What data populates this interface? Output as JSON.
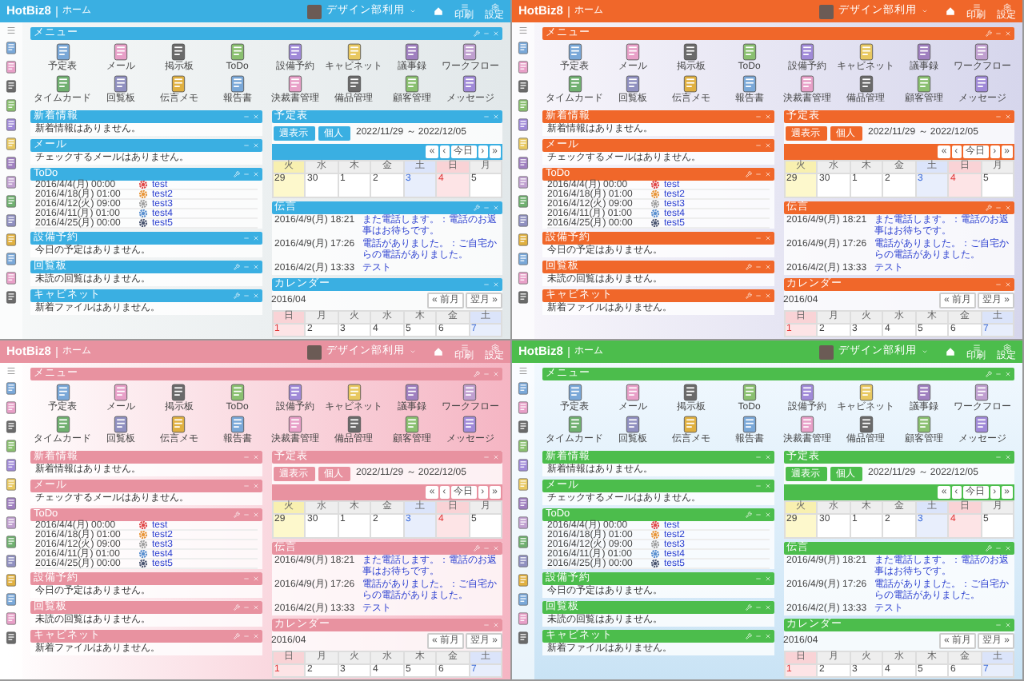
{
  "screens": [
    {
      "kind": "waves",
      "color": "#3aafe2",
      "logo": "HotBiz8",
      "page": "ホーム",
      "user": "デザイン部利用",
      "header_labels": [
        "印刷",
        "設定"
      ],
      "menu": {
        "title": "メニュー",
        "items": [
          "予定表",
          "メール",
          "掲示板",
          "ToDo",
          "設備予約",
          "キャビネット",
          "議事録",
          "ワークフロー",
          "タイムカード",
          "回覧板",
          "伝言メモ",
          "報告書",
          "決裁書管理",
          "備品管理",
          "顧客管理",
          "メッセージ"
        ]
      },
      "left_panels": [
        {
          "kind": "message",
          "title": "新着情報",
          "settings": false,
          "text": "新着情報はありません。"
        },
        {
          "kind": "message",
          "title": "メール",
          "settings": false,
          "text": "チェックするメールはありません。"
        },
        {
          "kind": "todo",
          "title": "ToDo",
          "settings": true,
          "rows": [
            {
              "date": "2016/4/4(月) 00:00",
              "name": "test",
              "color": "#e04848"
            },
            {
              "date": "2016/4/18(月) 01:00",
              "name": "test2",
              "color": "#e8963a"
            },
            {
              "date": "2016/4/12(火) 09:00",
              "name": "test3",
              "color": "#a0a0a0"
            },
            {
              "date": "2016/4/11(月) 01:00",
              "name": "test4",
              "color": "#5a90d0"
            },
            {
              "date": "2016/4/25(月) 00:00",
              "name": "test5",
              "color": "#4a5570"
            }
          ]
        },
        {
          "kind": "message",
          "title": "設備予約",
          "settings": false,
          "text": "今日の予定はありません。"
        },
        {
          "kind": "message",
          "title": "回覧板",
          "settings": true,
          "text": "未読の回覧はありません。"
        },
        {
          "kind": "message",
          "title": "キャビネット",
          "settings": true,
          "text": "新着ファイルはありません。"
        }
      ],
      "schedule": {
        "title": "予定表",
        "buttons": [
          "週表示",
          "個人"
        ],
        "range": "2022/11/29 ～ 2022/12/05",
        "nav": [
          "«",
          "‹",
          "今日",
          "›",
          "»"
        ],
        "columns": [
          {
            "head": "火",
            "day": "29",
            "kind": "today"
          },
          {
            "head": "水",
            "day": "30",
            "kind": "day"
          },
          {
            "head": "木",
            "day": "1",
            "kind": "day"
          },
          {
            "head": "金",
            "day": "2",
            "kind": "day"
          },
          {
            "head": "土",
            "day": "3",
            "kind": "sat"
          },
          {
            "head": "日",
            "day": "4",
            "kind": "sun"
          },
          {
            "head": "月",
            "day": "5",
            "kind": "day"
          }
        ]
      },
      "memo": {
        "title": "伝言",
        "rows": [
          {
            "time": "2016/4/9(月) 18:21",
            "text": "また電話します。：電話のお返事はお待ちです。"
          },
          {
            "time": "2016/4/9(月) 17:26",
            "text": "電話がありました。：ご自宅からの電話がありました。"
          },
          {
            "time": "2016/4/2(月) 13:33",
            "text": "テスト"
          }
        ]
      },
      "calendar": {
        "title": "カレンダー",
        "month": "2016/04",
        "nav": [
          "« 前月",
          "翌月 »"
        ],
        "columns": [
          {
            "head": "日",
            "day": "1",
            "kind": "sun"
          },
          {
            "head": "月",
            "day": "2",
            "kind": "day"
          },
          {
            "head": "火",
            "day": "3",
            "kind": "day"
          },
          {
            "head": "水",
            "day": "4",
            "kind": "day"
          },
          {
            "head": "木",
            "day": "5",
            "kind": "day"
          },
          {
            "head": "金",
            "day": "6",
            "kind": "day"
          },
          {
            "head": "土",
            "day": "7",
            "kind": "sat"
          }
        ]
      }
    },
    {
      "kind": "bubbles",
      "color": "#f0672a",
      "logo": "HotBiz8",
      "page": "ホーム",
      "user": "デザイン部利用",
      "header_labels": [
        "印刷",
        "設定"
      ],
      "menu": {
        "title": "メニュー",
        "items": [
          "予定表",
          "メール",
          "掲示板",
          "ToDo",
          "設備予約",
          "キャビネット",
          "議事録",
          "ワークフロー",
          "タイムカード",
          "回覧板",
          "伝言メモ",
          "報告書",
          "決裁書管理",
          "備品管理",
          "顧客管理",
          "メッセージ"
        ]
      },
      "left_panels": [
        {
          "kind": "message",
          "title": "新着情報",
          "settings": false,
          "text": "新着情報はありません。"
        },
        {
          "kind": "message",
          "title": "メール",
          "settings": false,
          "text": "チェックするメールはありません。"
        },
        {
          "kind": "todo",
          "title": "ToDo",
          "settings": true,
          "rows": [
            {
              "date": "2016/4/4(月) 00:00",
              "name": "test",
              "color": "#e04848"
            },
            {
              "date": "2016/4/18(月) 01:00",
              "name": "test2",
              "color": "#e8963a"
            },
            {
              "date": "2016/4/12(火) 09:00",
              "name": "test3",
              "color": "#a0a0a0"
            },
            {
              "date": "2016/4/11(月) 01:00",
              "name": "test4",
              "color": "#5a90d0"
            },
            {
              "date": "2016/4/25(月) 00:00",
              "name": "test5",
              "color": "#4a5570"
            }
          ]
        },
        {
          "kind": "message",
          "title": "設備予約",
          "settings": false,
          "text": "今日の予定はありません。"
        },
        {
          "kind": "message",
          "title": "回覧板",
          "settings": true,
          "text": "未読の回覧はありません。"
        },
        {
          "kind": "message",
          "title": "キャビネット",
          "settings": true,
          "text": "新着ファイルはありません。"
        }
      ],
      "schedule": {
        "title": "予定表",
        "buttons": [
          "週表示",
          "個人"
        ],
        "range": "2022/11/29 ～ 2022/12/05",
        "nav": [
          "«",
          "‹",
          "今日",
          "›",
          "»"
        ],
        "columns": [
          {
            "head": "火",
            "day": "29",
            "kind": "today"
          },
          {
            "head": "水",
            "day": "30",
            "kind": "day"
          },
          {
            "head": "木",
            "day": "1",
            "kind": "day"
          },
          {
            "head": "金",
            "day": "2",
            "kind": "day"
          },
          {
            "head": "土",
            "day": "3",
            "kind": "sat"
          },
          {
            "head": "日",
            "day": "4",
            "kind": "sun"
          },
          {
            "head": "月",
            "day": "5",
            "kind": "day"
          }
        ]
      },
      "memo": {
        "title": "伝言",
        "rows": [
          {
            "time": "2016/4/9(月) 18:21",
            "text": "また電話します。：電話のお返事はお待ちです。"
          },
          {
            "time": "2016/4/9(月) 17:26",
            "text": "電話がありました。：ご自宅からの電話がありました。"
          },
          {
            "time": "2016/4/2(月) 13:33",
            "text": "テスト"
          }
        ]
      },
      "calendar": {
        "title": "カレンダー",
        "month": "2016/04",
        "nav": [
          "« 前月",
          "翌月 »"
        ],
        "columns": [
          {
            "head": "日",
            "day": "1",
            "kind": "sun"
          },
          {
            "head": "月",
            "day": "2",
            "kind": "day"
          },
          {
            "head": "火",
            "day": "3",
            "kind": "day"
          },
          {
            "head": "水",
            "day": "4",
            "kind": "day"
          },
          {
            "head": "木",
            "day": "5",
            "kind": "day"
          },
          {
            "head": "金",
            "day": "6",
            "kind": "day"
          },
          {
            "head": "土",
            "day": "7",
            "kind": "sat"
          }
        ]
      }
    },
    {
      "kind": "sakura",
      "color": "#e892a0",
      "logo": "HotBiz8",
      "page": "ホーム",
      "user": "デザイン部利用",
      "header_labels": [
        "印刷",
        "設定"
      ],
      "menu": {
        "title": "メニュー",
        "items": [
          "予定表",
          "メール",
          "掲示板",
          "ToDo",
          "設備予約",
          "キャビネット",
          "議事録",
          "ワークフロー",
          "タイムカード",
          "回覧板",
          "伝言メモ",
          "報告書",
          "決裁書管理",
          "備品管理",
          "顧客管理",
          "メッセージ"
        ]
      },
      "left_panels": [
        {
          "kind": "message",
          "title": "新着情報",
          "settings": false,
          "text": "新着情報はありません。"
        },
        {
          "kind": "message",
          "title": "メール",
          "settings": false,
          "text": "チェックするメールはありません。"
        },
        {
          "kind": "todo",
          "title": "ToDo",
          "settings": true,
          "rows": [
            {
              "date": "2016/4/4(月) 00:00",
              "name": "test",
              "color": "#e04848"
            },
            {
              "date": "2016/4/18(月) 01:00",
              "name": "test2",
              "color": "#e8963a"
            },
            {
              "date": "2016/4/12(火) 09:00",
              "name": "test3",
              "color": "#a0a0a0"
            },
            {
              "date": "2016/4/11(月) 01:00",
              "name": "test4",
              "color": "#5a90d0"
            },
            {
              "date": "2016/4/25(月) 00:00",
              "name": "test5",
              "color": "#4a5570"
            }
          ]
        },
        {
          "kind": "message",
          "title": "設備予約",
          "settings": false,
          "text": "今日の予定はありません。"
        },
        {
          "kind": "message",
          "title": "回覧板",
          "settings": true,
          "text": "未読の回覧はありません。"
        },
        {
          "kind": "message",
          "title": "キャビネット",
          "settings": true,
          "text": "新着ファイルはありません。"
        }
      ],
      "schedule": {
        "title": "予定表",
        "buttons": [
          "週表示",
          "個人"
        ],
        "range": "2022/11/29 ～ 2022/12/05",
        "nav": [
          "«",
          "‹",
          "今日",
          "›",
          "»"
        ],
        "columns": [
          {
            "head": "火",
            "day": "29",
            "kind": "today"
          },
          {
            "head": "水",
            "day": "30",
            "kind": "day"
          },
          {
            "head": "木",
            "day": "1",
            "kind": "day"
          },
          {
            "head": "金",
            "day": "2",
            "kind": "day"
          },
          {
            "head": "土",
            "day": "3",
            "kind": "sat"
          },
          {
            "head": "日",
            "day": "4",
            "kind": "sun"
          },
          {
            "head": "月",
            "day": "5",
            "kind": "day"
          }
        ]
      },
      "memo": {
        "title": "伝言",
        "rows": [
          {
            "time": "2016/4/9(月) 18:21",
            "text": "また電話します。：電話のお返事はお待ちです。"
          },
          {
            "time": "2016/4/9(月) 17:26",
            "text": "電話がありました。：ご自宅からの電話がありました。"
          },
          {
            "time": "2016/4/2(月) 13:33",
            "text": "テスト"
          }
        ]
      },
      "calendar": {
        "title": "カレンダー",
        "month": "2016/04",
        "nav": [
          "« 前月",
          "翌月 »"
        ],
        "columns": [
          {
            "head": "日",
            "day": "1",
            "kind": "sun"
          },
          {
            "head": "月",
            "day": "2",
            "kind": "day"
          },
          {
            "head": "火",
            "day": "3",
            "kind": "day"
          },
          {
            "head": "水",
            "day": "4",
            "kind": "day"
          },
          {
            "head": "木",
            "day": "5",
            "kind": "day"
          },
          {
            "head": "金",
            "day": "6",
            "kind": "day"
          },
          {
            "head": "土",
            "day": "7",
            "kind": "sat"
          }
        ]
      }
    },
    {
      "kind": "sky",
      "color": "#4cbd4c",
      "logo": "HotBiz8",
      "page": "ホーム",
      "user": "デザイン部利用",
      "header_labels": [
        "印刷",
        "設定"
      ],
      "menu": {
        "title": "メニュー",
        "items": [
          "予定表",
          "メール",
          "掲示板",
          "ToDo",
          "設備予約",
          "キャビネット",
          "議事録",
          "ワークフロー",
          "タイムカード",
          "回覧板",
          "伝言メモ",
          "報告書",
          "決裁書管理",
          "備品管理",
          "顧客管理",
          "メッセージ"
        ]
      },
      "left_panels": [
        {
          "kind": "message",
          "title": "新着情報",
          "settings": false,
          "text": "新着情報はありません。"
        },
        {
          "kind": "message",
          "title": "メール",
          "settings": false,
          "text": "チェックするメールはありません。"
        },
        {
          "kind": "todo",
          "title": "ToDo",
          "settings": true,
          "rows": [
            {
              "date": "2016/4/4(月) 00:00",
              "name": "test",
              "color": "#e04848"
            },
            {
              "date": "2016/4/18(月) 01:00",
              "name": "test2",
              "color": "#e8963a"
            },
            {
              "date": "2016/4/12(火) 09:00",
              "name": "test3",
              "color": "#a0a0a0"
            },
            {
              "date": "2016/4/11(月) 01:00",
              "name": "test4",
              "color": "#5a90d0"
            },
            {
              "date": "2016/4/25(月) 00:00",
              "name": "test5",
              "color": "#4a5570"
            }
          ]
        },
        {
          "kind": "message",
          "title": "設備予約",
          "settings": false,
          "text": "今日の予定はありません。"
        },
        {
          "kind": "message",
          "title": "回覧板",
          "settings": true,
          "text": "未読の回覧はありません。"
        },
        {
          "kind": "message",
          "title": "キャビネット",
          "settings": true,
          "text": "新着ファイルはありません。"
        }
      ],
      "schedule": {
        "title": "予定表",
        "buttons": [
          "週表示",
          "個人"
        ],
        "range": "2022/11/29 ～ 2022/12/05",
        "nav": [
          "«",
          "‹",
          "今日",
          "›",
          "»"
        ],
        "columns": [
          {
            "head": "火",
            "day": "29",
            "kind": "today"
          },
          {
            "head": "水",
            "day": "30",
            "kind": "day"
          },
          {
            "head": "木",
            "day": "1",
            "kind": "day"
          },
          {
            "head": "金",
            "day": "2",
            "kind": "day"
          },
          {
            "head": "土",
            "day": "3",
            "kind": "sat"
          },
          {
            "head": "日",
            "day": "4",
            "kind": "sun"
          },
          {
            "head": "月",
            "day": "5",
            "kind": "day"
          }
        ]
      },
      "memo": {
        "title": "伝言",
        "rows": [
          {
            "time": "2016/4/9(月) 18:21",
            "text": "また電話します。：電話のお返事はお待ちです。"
          },
          {
            "time": "2016/4/9(月) 17:26",
            "text": "電話がありました。：ご自宅からの電話がありました。"
          },
          {
            "time": "2016/4/2(月) 13:33",
            "text": "テスト"
          }
        ]
      },
      "calendar": {
        "title": "カレンダー",
        "month": "2016/04",
        "nav": [
          "« 前月",
          "翌月 »"
        ],
        "columns": [
          {
            "head": "日",
            "day": "1",
            "kind": "sun"
          },
          {
            "head": "月",
            "day": "2",
            "kind": "day"
          },
          {
            "head": "火",
            "day": "3",
            "kind": "day"
          },
          {
            "head": "水",
            "day": "4",
            "kind": "day"
          },
          {
            "head": "木",
            "day": "5",
            "kind": "day"
          },
          {
            "head": "金",
            "day": "6",
            "kind": "day"
          },
          {
            "head": "土",
            "day": "7",
            "kind": "sat"
          }
        ]
      }
    }
  ]
}
